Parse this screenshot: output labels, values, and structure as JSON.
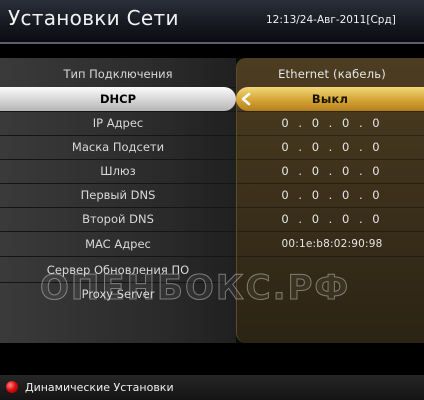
{
  "header": {
    "title": "Установки Сети",
    "clock": "12:13/24-Авг-2011[Срд]"
  },
  "settings": [
    {
      "label": "Тип Подключения",
      "value": "Ethernet (кабель)"
    },
    {
      "label": "DHCP",
      "value": "Выкл",
      "selected": true
    },
    {
      "label": "IP Адрес",
      "value": "0 . 0 . 0 . 0"
    },
    {
      "label": "Маска Подсети",
      "value": "0 . 0 . 0 . 0"
    },
    {
      "label": "Шлюз",
      "value": "0 . 0 . 0 . 0"
    },
    {
      "label": "Первый DNS",
      "value": "0 . 0 . 0 . 0"
    },
    {
      "label": "Второй DNS",
      "value": "0 . 0 . 0 . 0"
    },
    {
      "label": "MAC Адрес",
      "value": "00:1e:b8:02:90:98"
    },
    {
      "label": "Сервер Обновления ПО",
      "value": ""
    },
    {
      "label": "Proxy Server",
      "value": ""
    }
  ],
  "watermark": "ОПЕНБОКС.РФ",
  "footer": {
    "button_color": "red",
    "label": "Динамические Установки"
  },
  "colors": {
    "selected_value_bg": "#d7a83a",
    "selected_label_bg": "#e0e0e0",
    "value_column_bg": "#3d311b",
    "label_column_bg": "#2f2f2f"
  }
}
